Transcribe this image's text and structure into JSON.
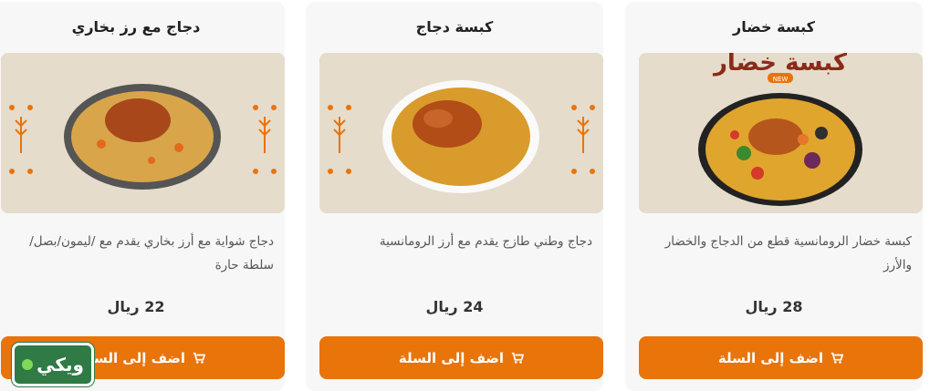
{
  "cards": [
    {
      "title": "كبسة خضار",
      "image_banner": "كبسة خضار",
      "image_badge": "NEW",
      "description": "كبسة خضار الرومانسية قطع من الدجاج والخضار والأرز",
      "price": "28 ريال",
      "button": "اضف إلى السلة"
    },
    {
      "title": "كبسة دجاج",
      "description": "دجاج وطني طازج يقدم مع أرز الرومانسية",
      "price": "24 ريال",
      "button": "اضف إلى السلة"
    },
    {
      "title": "دجاج مع رز بخاري",
      "description": "دجاج شواية مع أرز بخاري يقدم مع /ليمون/بصل/سلطة حارة",
      "price": "22 ريال",
      "button": "اضف إلى السلة"
    }
  ],
  "watermark": {
    "text": "ويكي"
  },
  "colors": {
    "accent": "#e8740a",
    "card_bg": "#f7f7f7",
    "image_bg": "#e6dccc",
    "logo_bg": "#2f7a45"
  },
  "icons": {
    "cart": "cart-icon",
    "wheat": "wheat-icon"
  }
}
